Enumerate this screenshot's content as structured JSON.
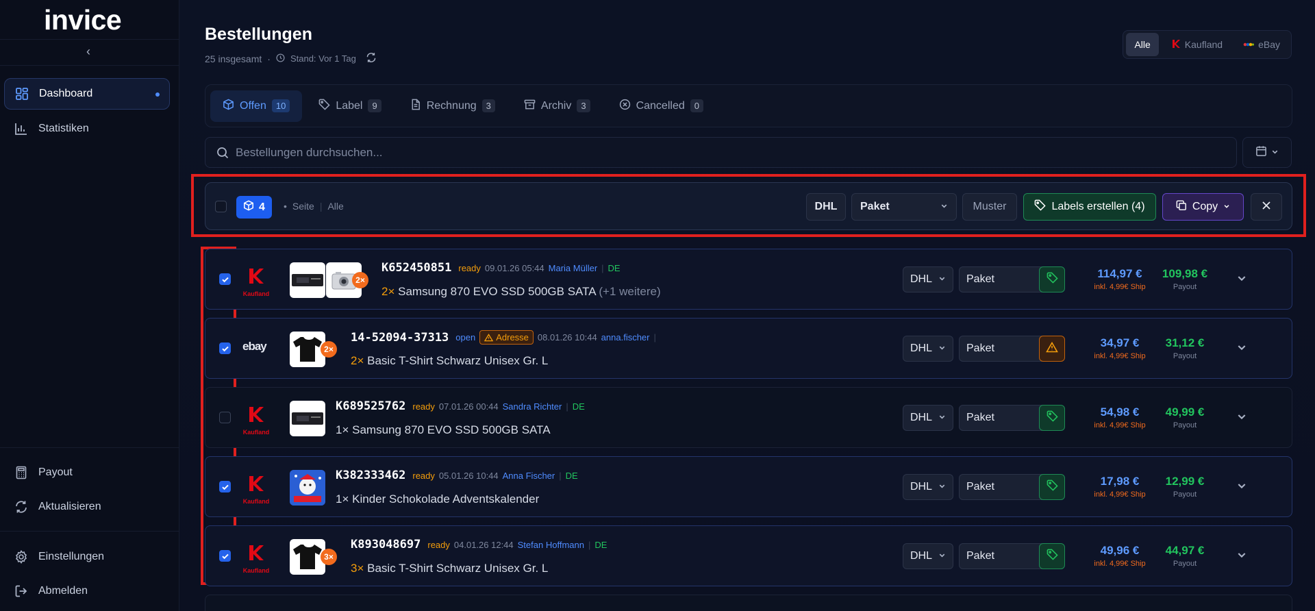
{
  "app": {
    "logo": "invice",
    "colors": {
      "accent": "#2563eb",
      "kaufland": "#e10915",
      "ship": "#f26b1d",
      "ready": "#f59e0b",
      "payout": "#22c55e"
    }
  },
  "sidebar": {
    "items": [
      {
        "label": "Dashboard",
        "icon": "dashboard-icon"
      },
      {
        "label": "Statistiken",
        "icon": "chart-icon"
      }
    ],
    "bottom": [
      {
        "label": "Payout",
        "icon": "calculator-icon"
      },
      {
        "label": "Aktualisieren",
        "icon": "refresh-icon"
      },
      {
        "label": "Einstellungen",
        "icon": "gear-icon"
      },
      {
        "label": "Abmelden",
        "icon": "logout-icon"
      }
    ]
  },
  "header": {
    "title": "Bestellungen",
    "total": "25 insgesamt",
    "dot": "·",
    "status": "Stand: Vor 1 Tag"
  },
  "marketplace_filter": {
    "options": [
      "Alle",
      "Kaufland",
      "eBay"
    ],
    "selected": "Alle"
  },
  "tabs": [
    {
      "label": "Offen",
      "count": "10",
      "icon": "box-icon"
    },
    {
      "label": "Label",
      "count": "9",
      "icon": "tag-icon"
    },
    {
      "label": "Rechnung",
      "count": "3",
      "icon": "document-icon"
    },
    {
      "label": "Archiv",
      "count": "3",
      "icon": "archive-icon"
    },
    {
      "label": "Cancelled",
      "count": "0",
      "icon": "cancel-icon"
    }
  ],
  "search": {
    "placeholder": "Bestellungen durchsuchen..."
  },
  "bulk": {
    "selected_count": "4",
    "dot": "•",
    "page_label": "Seite",
    "sep": "|",
    "all_label": "Alle",
    "carrier": "DHL",
    "package": "Paket",
    "template": "Muster",
    "create_labels": "Labels erstellen (4)",
    "copy": "Copy"
  },
  "orders": [
    {
      "marketplace": "kaufland",
      "market_text": "Kaufland",
      "qty_badge": "2×",
      "thumbs": [
        "ssd",
        "camera"
      ],
      "id": "K652450851",
      "status": "ready",
      "warning": "",
      "time": "09.01.26 05:44",
      "customer": "Maria Müller",
      "sep": "|",
      "country": "DE",
      "qty": "2×",
      "product": "Samsung 870 EVO SSD 500GB SATA",
      "more": "(+1 weitere)",
      "carrier": "DHL",
      "package": "Paket",
      "label_state": "ok",
      "price": "114,97 €",
      "ship": "inkl. 4,99€ Ship",
      "payout": "109,98 €",
      "payout_label": "Payout",
      "checked": true
    },
    {
      "marketplace": "ebay",
      "market_text": "ebay",
      "qty_badge": "2×",
      "thumbs": [
        "tshirt"
      ],
      "id": "14-52094-37313",
      "status": "open",
      "warning": "Adresse",
      "time": "08.01.26 10:44",
      "customer": "anna.fischer",
      "sep": "|",
      "country": "",
      "qty": "2×",
      "product": "Basic T-Shirt Schwarz Unisex Gr. L",
      "more": "",
      "carrier": "DHL",
      "package": "Paket",
      "label_state": "warn",
      "price": "34,97 €",
      "ship": "inkl. 4,99€ Ship",
      "payout": "31,12 €",
      "payout_label": "Payout",
      "checked": true
    },
    {
      "marketplace": "kaufland",
      "market_text": "Kaufland",
      "qty_badge": "",
      "thumbs": [
        "ssd"
      ],
      "id": "K689525762",
      "status": "ready",
      "warning": "",
      "time": "07.01.26 00:44",
      "customer": "Sandra Richter",
      "sep": "|",
      "country": "DE",
      "qty": "1×",
      "product": "Samsung 870 EVO SSD 500GB SATA",
      "more": "",
      "carrier": "DHL",
      "package": "Paket",
      "label_state": "ok",
      "price": "54,98 €",
      "ship": "inkl. 4,99€ Ship",
      "payout": "49,99 €",
      "payout_label": "Payout",
      "checked": false
    },
    {
      "marketplace": "kaufland",
      "market_text": "Kaufland",
      "qty_badge": "",
      "thumbs": [
        "advent"
      ],
      "id": "K382333462",
      "status": "ready",
      "warning": "",
      "time": "05.01.26 10:44",
      "customer": "Anna Fischer",
      "sep": "|",
      "country": "DE",
      "qty": "1×",
      "product": "Kinder Schokolade Adventskalender",
      "more": "",
      "carrier": "DHL",
      "package": "Paket",
      "label_state": "ok",
      "price": "17,98 €",
      "ship": "inkl. 4,99€ Ship",
      "payout": "12,99 €",
      "payout_label": "Payout",
      "checked": true
    },
    {
      "marketplace": "kaufland",
      "market_text": "Kaufland",
      "qty_badge": "3×",
      "thumbs": [
        "tshirt"
      ],
      "id": "K893048697",
      "status": "ready",
      "warning": "",
      "time": "04.01.26 12:44",
      "customer": "Stefan Hoffmann",
      "sep": "|",
      "country": "DE",
      "qty": "3×",
      "product": "Basic T-Shirt Schwarz Unisex Gr. L",
      "more": "",
      "carrier": "DHL",
      "package": "Paket",
      "label_state": "ok",
      "price": "49,96 €",
      "ship": "inkl. 4,99€ Ship",
      "payout": "44,97 €",
      "payout_label": "Payout",
      "checked": true
    }
  ]
}
